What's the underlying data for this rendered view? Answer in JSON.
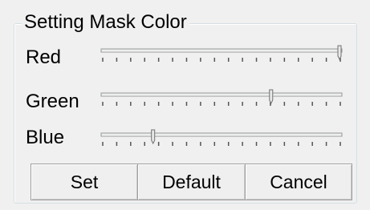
{
  "dialog": {
    "group_title": "Setting Mask Color",
    "sliders": [
      {
        "label": "Red",
        "value": 255,
        "min": 0,
        "max": 255
      },
      {
        "label": "Green",
        "value": 180,
        "min": 0,
        "max": 255
      },
      {
        "label": "Blue",
        "value": 55,
        "min": 0,
        "max": 255
      }
    ],
    "buttons": {
      "set": "Set",
      "default": "Default",
      "cancel": "Cancel"
    }
  }
}
